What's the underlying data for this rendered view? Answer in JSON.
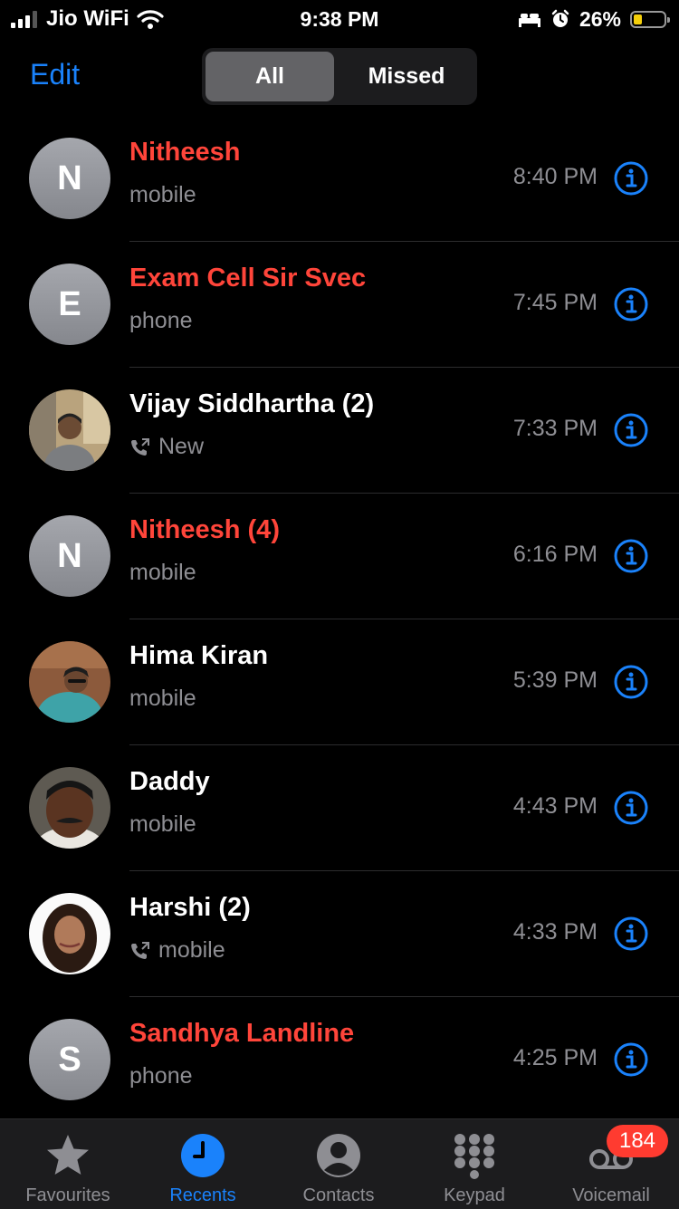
{
  "status_bar": {
    "carrier": "Jio WiFi",
    "time": "9:38 PM",
    "battery_percent": "26%",
    "battery_level": 0.26,
    "icons": [
      "signal-icon",
      "wifi-icon",
      "bed-icon",
      "alarm-icon",
      "battery-icon"
    ]
  },
  "header": {
    "edit_label": "Edit",
    "segments": [
      "All",
      "Missed"
    ],
    "selected_segment": "All"
  },
  "calls": [
    {
      "name": "Nitheesh",
      "missed": true,
      "avatar_letter": "N",
      "detail": "mobile",
      "outgoing": false,
      "time": "8:40 PM"
    },
    {
      "name": "Exam Cell Sir Svec",
      "missed": true,
      "avatar_letter": "E",
      "detail": "phone",
      "outgoing": false,
      "time": "7:45 PM"
    },
    {
      "name": "Vijay Siddhartha (2)",
      "missed": false,
      "avatar_letter": "",
      "detail": "New",
      "outgoing": true,
      "time": "7:33 PM"
    },
    {
      "name": "Nitheesh (4)",
      "missed": true,
      "avatar_letter": "N",
      "detail": "mobile",
      "outgoing": false,
      "time": "6:16 PM"
    },
    {
      "name": "Hima Kiran",
      "missed": false,
      "avatar_letter": "",
      "detail": "mobile",
      "outgoing": false,
      "time": "5:39 PM"
    },
    {
      "name": "Daddy",
      "missed": false,
      "avatar_letter": "",
      "detail": "mobile",
      "outgoing": false,
      "time": "4:43 PM"
    },
    {
      "name": "Harshi (2)",
      "missed": false,
      "avatar_letter": "",
      "detail": "mobile",
      "outgoing": true,
      "time": "4:33 PM"
    },
    {
      "name": "Sandhya Landline",
      "missed": true,
      "avatar_letter": "S",
      "detail": "phone",
      "outgoing": false,
      "time": "4:25 PM"
    }
  ],
  "tab_bar": {
    "tabs": [
      {
        "label": "Favourites",
        "icon": "star-icon",
        "active": false
      },
      {
        "label": "Recents",
        "icon": "clock-icon",
        "active": true
      },
      {
        "label": "Contacts",
        "icon": "person-icon",
        "active": false
      },
      {
        "label": "Keypad",
        "icon": "keypad-icon",
        "active": false
      },
      {
        "label": "Voicemail",
        "icon": "voicemail-icon",
        "active": false
      }
    ],
    "voicemail_badge": "184"
  },
  "colors": {
    "accent": "#1a82fb",
    "missed": "#ff453a",
    "secondary_text": "#8e8e93",
    "badge": "#ff3b30"
  }
}
